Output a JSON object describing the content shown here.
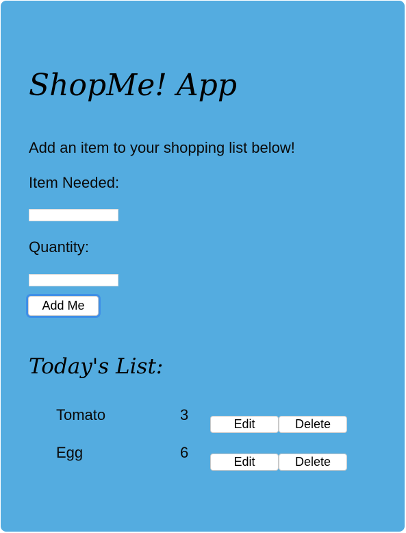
{
  "app": {
    "title": "ShopMe! App",
    "intro": "Add an item to your shopping list below!"
  },
  "form": {
    "item_label": "Item Needed:",
    "item_value": "",
    "quantity_label": "Quantity:",
    "quantity_value": "",
    "add_button_label": "Add Me"
  },
  "list": {
    "title": "Today's List:",
    "edit_label": "Edit",
    "delete_label": "Delete",
    "items": [
      {
        "name": "Tomato",
        "quantity": "3"
      },
      {
        "name": "Egg",
        "quantity": "6"
      }
    ]
  },
  "colors": {
    "background": "#54ace0",
    "button_focus_ring": "#3f8fe6"
  }
}
